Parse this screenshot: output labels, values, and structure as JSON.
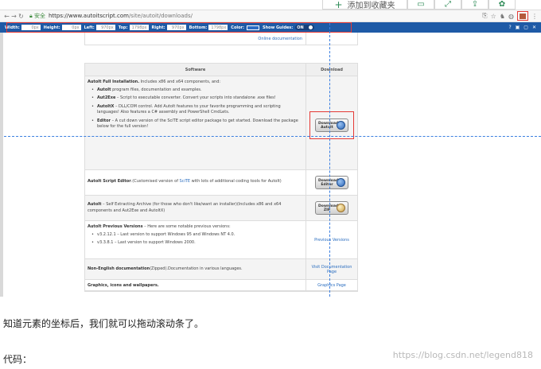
{
  "blog_toolbar": {
    "add_to_favorites": "添加到收藏夹",
    "icons": [
      "bookmark-icon",
      "expand-icon",
      "export-icon",
      "settings-icon"
    ]
  },
  "browser": {
    "secure_label": "安全",
    "url_host": "https://www.autoitscript.com",
    "url_path": "/site/autoit/downloads/"
  },
  "ruler": {
    "fields": [
      {
        "label": "Width:",
        "value": "0px"
      },
      {
        "label": "Height:",
        "value": "0px"
      },
      {
        "label": "Left:",
        "value": "970px"
      },
      {
        "label": "Top:",
        "value": "1798px"
      },
      {
        "label": "Right:",
        "value": "970px"
      },
      {
        "label": "Bottom:",
        "value": "1798px"
      }
    ],
    "color_label": "Color:",
    "color_value": "#2b6cc4",
    "guides_label": "Show Guides:",
    "guides_state": "ON"
  },
  "page": {
    "online_docs": "Online documentation",
    "table": {
      "header_software": "Software",
      "header_download": "Download",
      "full": {
        "title": "AutoIt Full Installation.",
        "desc": " Includes x86 and x64 components, and:",
        "items": [
          {
            "name": "AutoIt",
            "text": " program files, documentation and examples."
          },
          {
            "name": "Aut2Exe",
            "text": " – Script to executable converter.  Convert your scripts into standalone .exe files!"
          },
          {
            "name": "AutoItX",
            "text": " – DLL/COM control.  Add AutoIt features to your favorite programming and scripting languages! Also features a C# assembly and PowerShell CmdLets."
          },
          {
            "name": "Editor",
            "text": " – A cut down version of the SciTE script editor package to get started. Download the package below for the full version!"
          }
        ],
        "button": "Download AutoIt"
      },
      "editor": {
        "title": "AutoIt Script Editor",
        "text_a": ".(Customised version of ",
        "link": "SciTE",
        "text_b": " with lots of additional coding tools for AutoIt)",
        "button": "Download Editor"
      },
      "selfext": {
        "title": "AutoIt",
        "text": " – Self Extracting Archive (for those who don't like/want an installer)(Includes x86 and x64 components and Aut2Exe and AutoItX)",
        "button": "Download ZIP"
      },
      "previous": {
        "title": "AutoIt Previous Versions",
        "desc": " – Here are some notable previous versions:",
        "items": [
          "v3.2.12.1 – Last version to support Windows 95 and Windows NT 4.0.",
          "v3.3.8.1 – Last version to support Windows 2000."
        ],
        "link": "Previous Versions"
      },
      "non_english": {
        "title": "Non-English documentation",
        "text": "(Zipped).Documentation in various languages.",
        "link": "Visit Documentation Page"
      },
      "graphics": {
        "title": "Graphics, icons and wallpapers.",
        "link": "Graphics Page"
      }
    }
  },
  "article": {
    "para1": "知道元素的坐标后，我们就可以拖动滚动条了。",
    "para2": "代码：",
    "watermark": "https://blog.csdn.net/legend818"
  }
}
